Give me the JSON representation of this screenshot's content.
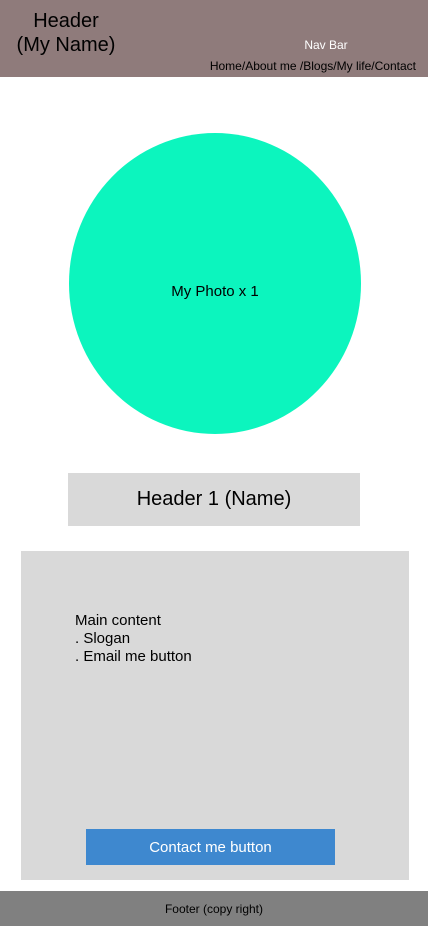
{
  "header": {
    "title_line1": "Header",
    "title_line2": "(My Name)",
    "nav_caption": "Nav Bar",
    "nav_links": [
      "Home",
      "/",
      "About me ",
      "/",
      "Blogs",
      "/",
      "My life",
      "/",
      "Contact"
    ]
  },
  "photo": {
    "label": "My Photo x 1"
  },
  "name_box": {
    "label": "Header 1 (Name)"
  },
  "main": {
    "lines": [
      "Main content",
      ". Slogan",
      ". Email me button"
    ],
    "contact_button_label": "Contact me button"
  },
  "footer": {
    "label": "Footer (copy right)"
  },
  "colors": {
    "header_bg": "#8f7b7b",
    "photo_bg": "#0cf5be",
    "panel_bg": "#d9d9d9",
    "button_bg": "#3e88cf",
    "footer_bg": "#808080"
  }
}
